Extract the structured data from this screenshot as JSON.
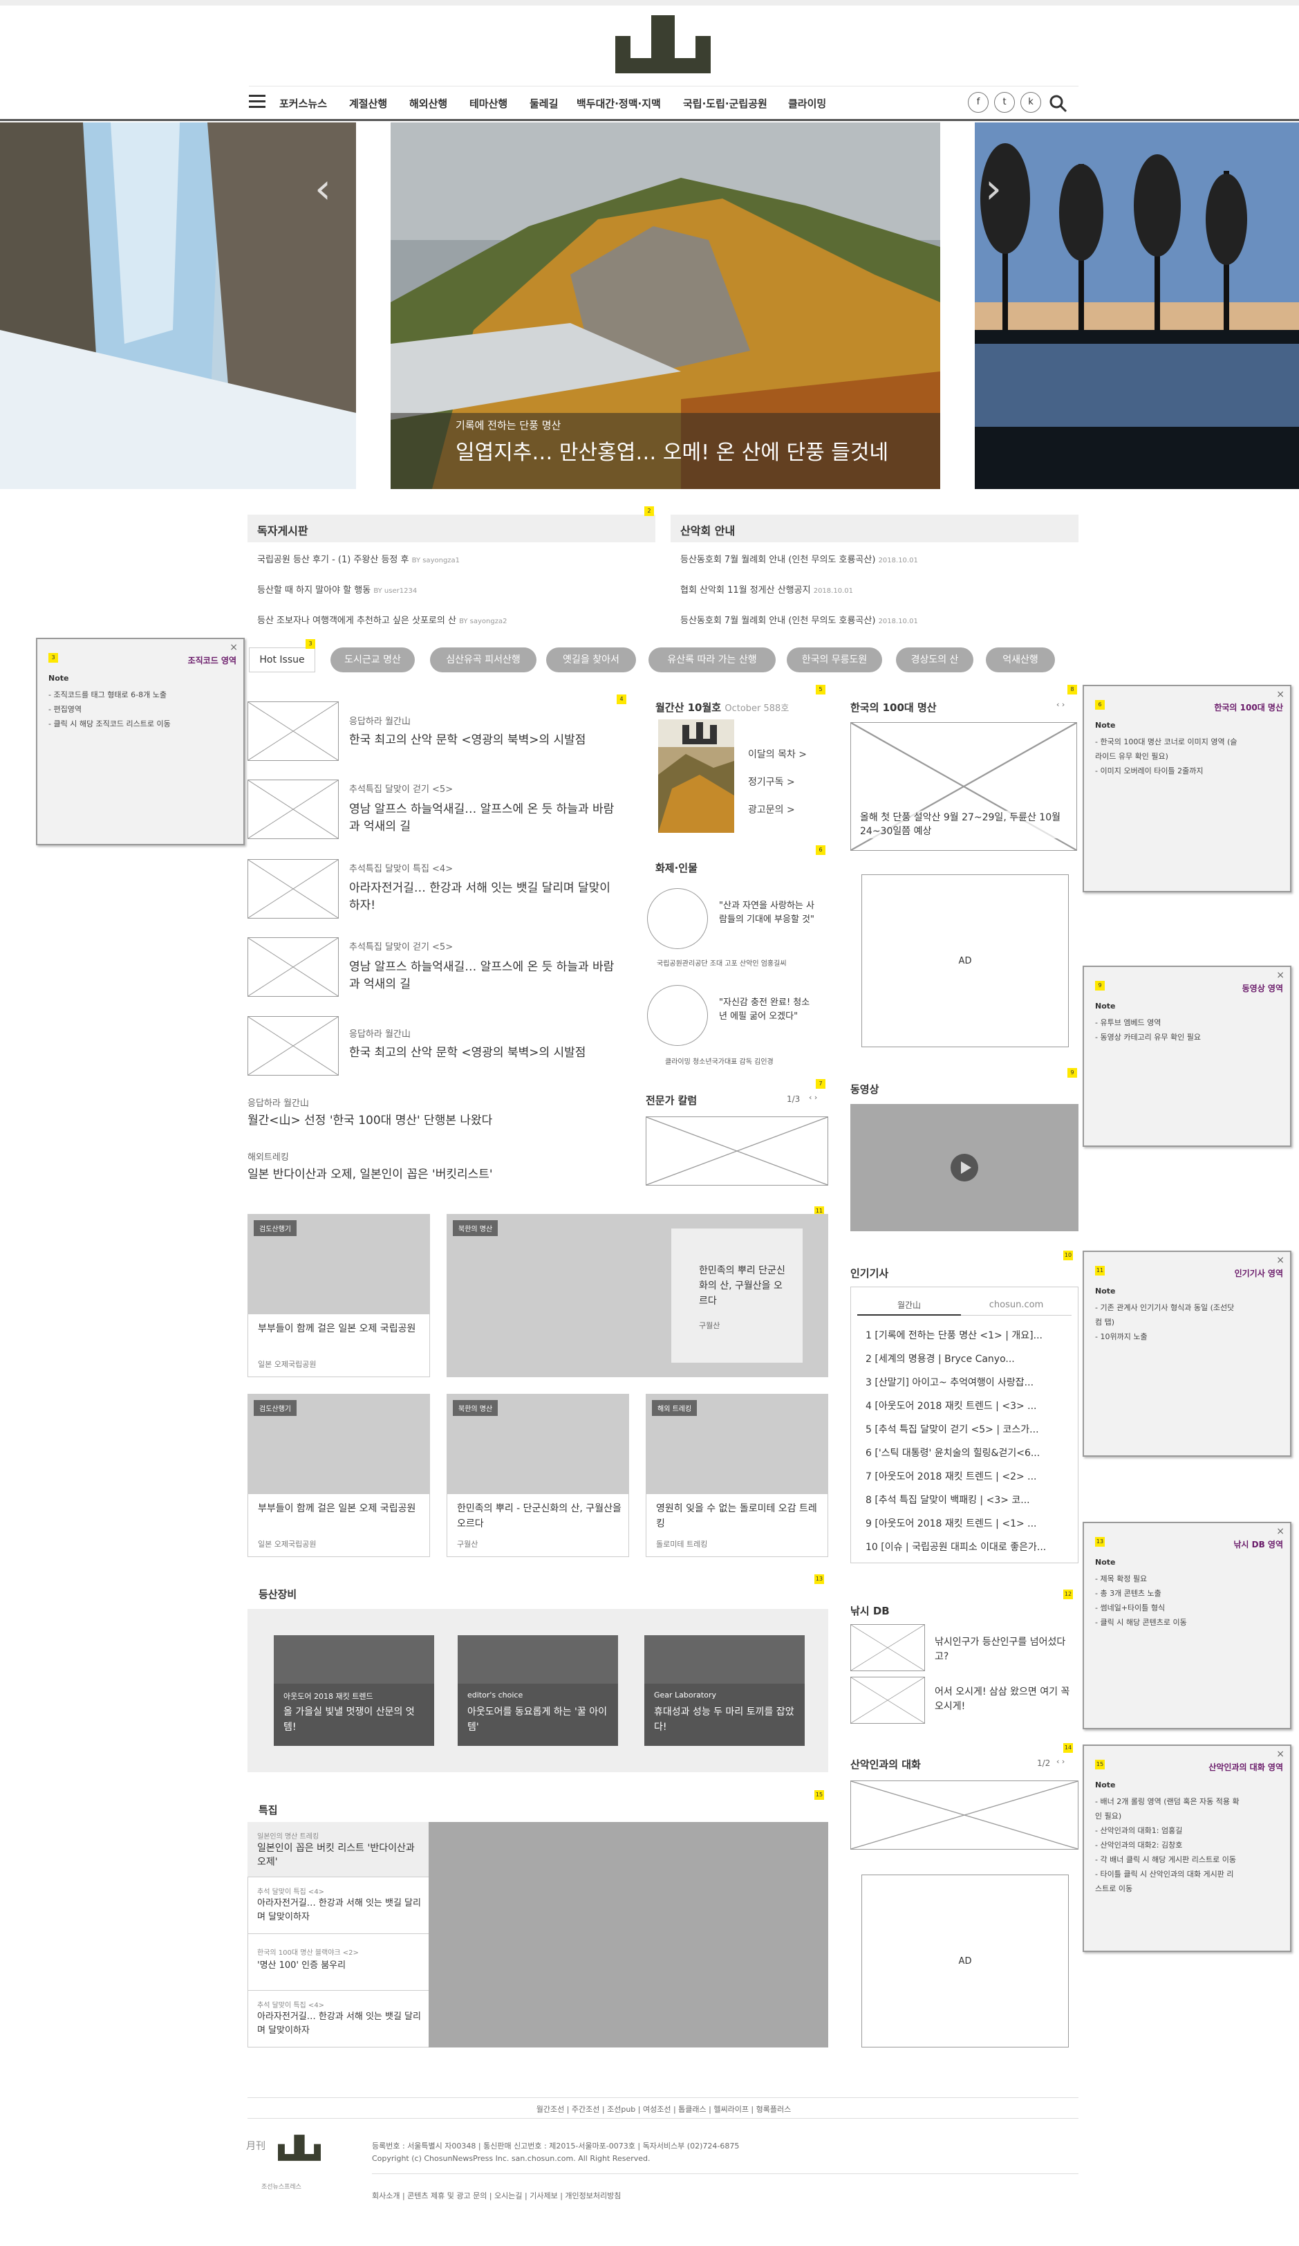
{
  "brand": {
    "logo": "山",
    "logo_small": "月刊",
    "publisher": "조선뉴스프레스"
  },
  "nav": {
    "items": [
      "포커스뉴스",
      "계절산행",
      "해외산행",
      "테마산행",
      "둘레길",
      "백두대간·정맥·지맥",
      "국립·도립·군립공원",
      "클라이밍"
    ],
    "social": [
      "f",
      "t",
      "k"
    ]
  },
  "hero": {
    "subtitle": "기록에 전하는 단풍 명산",
    "title": "일엽지추… 만산홍엽… 오메! 온 산에 단풍 들것네"
  },
  "readers_board": {
    "title": "독자게시판",
    "items": [
      {
        "text": "국립공원 등산 후기 - (1) 주왕산 등정 후",
        "by": "BY sayongza1"
      },
      {
        "text": "등산할 때 하지 말아야 할 행동",
        "by": "BY user1234"
      },
      {
        "text": "등산 조보자나 여행객에게 추천하고 싶은 삿포로의 산",
        "by": "BY sayongza2"
      }
    ]
  },
  "club_notice": {
    "title": "산악회 안내",
    "items": [
      {
        "text": "등산동호회 7월 월례회 안내 (인천 무의도 호룡곡산)",
        "date": "2018.10.01"
      },
      {
        "text": "협회 산악회 11월 정게산 산행공지",
        "date": "2018.10.01"
      },
      {
        "text": "등산동호회 7월 월례회 안내 (인천 무의도 호룡곡산)",
        "date": "2018.10.01"
      }
    ]
  },
  "hot_issue": {
    "label": "Hot Issue",
    "tags": [
      "도시근교 명산",
      "심산유곡 피서산행",
      "옛길을 찾아서",
      "유산록 따라 가는 산행",
      "한국의 무릉도원",
      "경상도의 산",
      "억새산행"
    ]
  },
  "articles": [
    {
      "cat": "응답하라 월간山",
      "title": "한국 최고의 산악 문학 <영광의 북벽>의 시발점"
    },
    {
      "cat": "추석특집 달맞이 걷기 <5>",
      "title": "영남 알프스 하늘억새길… 알프스에 온 듯 하늘과 바람과 억새의 길"
    },
    {
      "cat": "추석특집 달맞이 특집 <4>",
      "title": "아라자전거길… 한강과 서해 잇는 뱃길 달리며 달맞이하자!"
    },
    {
      "cat": "추석특집 달맞이 걷기 <5>",
      "title": "영남 알프스 하늘억새길… 알프스에 온 듯 하늘과 바람과 억새의 길"
    },
    {
      "cat": "응답하라 월간山",
      "title": "한국 최고의 산악 문학 <영광의 북벽>의 시발점"
    }
  ],
  "text_articles": [
    {
      "cat": "응답하라 월간山",
      "title": "월간<山> 선정 '한국 100대 명산' 단행본 나왔다"
    },
    {
      "cat": "해외트레킹",
      "title": "일본 반다이산과 오제, 일본인이 꼽은 '버킷리스트'"
    }
  ],
  "monthly": {
    "title": "월간산 10월호",
    "sub": "October 588호",
    "links": [
      "이달의 목차",
      "정기구독",
      "광고문의"
    ]
  },
  "people": {
    "title": "화제·인물",
    "items": [
      {
        "quote": "\"산과 자연을 사랑하는 사람들의 기대에 부응할 것\"",
        "cap": "국립공원관리공단 조대 고포 산악인 엄홍길씨"
      },
      {
        "quote": "\"자신감 충전 완료! 청소년 에필 굶어 오겠다\"",
        "cap": "클라이밍 청소년국가대표 감독 김인경"
      }
    ]
  },
  "column": {
    "title": "전문가 칼럼",
    "page": "1/3"
  },
  "top100": {
    "title": "한국의 100대 명산",
    "caption": "올해 첫 단풍 설악산 9월 27~29일, 두륜산 10월 24~30일쯤 예상"
  },
  "ad": {
    "label": "AD"
  },
  "video": {
    "title": "동영상"
  },
  "popular": {
    "title": "인기기사",
    "tabs": [
      "월간山",
      "chosun.com"
    ],
    "items": [
      "1  [기록에 전하는 단풍 명산 <1> | 개요]...",
      "2  [세계의 명용경 | Bryce Canyo...",
      "3  [산말기] 아이고~ 추억여행이 사랑잡...",
      "4  [아웃도어 2018 재킷 트렌드 | <3> ...",
      "5  [추석 특집 달맞이 걷기 <5> | 코스가...",
      "6  ['스틱 대통령' 윤치술의 힐링&걷기<6...",
      "7  [아웃도어 2018 재킷 트렌드 | <2> ...",
      "8  [추석 특집 달맞이 백패킹 | <3> 코...",
      "9  [아웃도어 2018 재킷 트렌드 | <1> ...",
      "10  [이슈 | 국립공원 대피소 이대로 좋은가..."
    ]
  },
  "fishing": {
    "title": "낚시 DB",
    "items": [
      "낚시인구가 등산인구를 넘어섰다고?",
      "어서 오시게! 삼삼 왔으면 여기 꼭 오시게!"
    ]
  },
  "talk": {
    "title": "산악인과의 대화",
    "page": "1/2"
  },
  "cards_row1": [
    {
      "label": "검도산행기",
      "title": "부부들이 함께 걸은 일본 오제 국립공원",
      "sub": "일본 오제국립공원"
    },
    {
      "label": "북한의 명산",
      "title": "한민족의 뿌리 단군신화의 산, 구월산을 오르다",
      "sub": "구월산"
    }
  ],
  "cards_row2": [
    {
      "label": "검도산행기",
      "title": "부부들이 함께 걸은 일본 오제 국립공원",
      "sub": "일본 오제국립공원"
    },
    {
      "label": "북한의 명산",
      "title": "한민족의 뿌리 - 단군신화의 산, 구월산을 오르다",
      "sub": "구월산"
    },
    {
      "label": "해외 트레킹",
      "title": "영원히 잊을 수 없는 돌로미테 오감 트레킹",
      "sub": "돌로미테 트레킹"
    }
  ],
  "equipment": {
    "title": "등산장비",
    "items": [
      {
        "label": "아웃도어 2018 재킷 트렌드",
        "title": "올 가을실 빛낼 멋쟁이 산문의 엇템!"
      },
      {
        "label": "editor's choice",
        "title": "아웃도어를 동요롭게 하는 '꿀 아이템'"
      },
      {
        "label": "Gear Laboratory",
        "title": "휴대성과 성능 두 마리 토끼를 잡았다!"
      }
    ]
  },
  "special": {
    "title": "특집",
    "items": [
      {
        "cat": "일본인의 명산 트레킹",
        "title": "일본인이 꼽은 버킷 리스트 '반다이산과 오제'"
      },
      {
        "cat": "추석 달맞이 특집 <4>",
        "title": "아라자전거길… 한강과 서해 잇는 뱃길 달리며 달맞이하자"
      },
      {
        "cat": "한국의 100대 명산 블랙야크 <2>",
        "title": "'명산 100' 인증 붐우리"
      },
      {
        "cat": "추석 달맞이 특집 <4>",
        "title": "아라자전거길… 한강과 서해 잇는 뱃길 달리며 달맞이하자"
      }
    ]
  },
  "notes": [
    {
      "num": "3",
      "title": "조직코드 영역",
      "label": "Note",
      "lines": [
        "- 조직코드를 태그 형태로 6-8개 노출",
        "- 편집영역",
        "- 클릭 시 해당 조직코드 리스트로 이동"
      ]
    },
    {
      "num": "6",
      "title": "한국의 100대 명산",
      "label": "Note",
      "lines": [
        "- 한국의 100대 명산 코너로 이미지 영역 (슬",
        "  라이드 유무 확인 필요)",
        "- 이미지 오버레이 타이틀 2줄까지"
      ]
    },
    {
      "num": "9",
      "title": "동영상 영역",
      "label": "Note",
      "lines": [
        "- 유투브 엠베드 영역",
        "- 동영상 카테고리 유무 확인 필요"
      ]
    },
    {
      "num": "11",
      "title": "인기기사 영역",
      "label": "Note",
      "lines": [
        "- 기존 관계사 인기기사 형식과 동일 (조선닷",
        "  컴 탭)",
        "- 10위까지 노출"
      ]
    },
    {
      "num": "13",
      "title": "낚시 DB 영역",
      "label": "Note",
      "lines": [
        "- 제목 확정 필요",
        "- 총 3개 콘텐츠 노출",
        "- 썸네일+타이틀 형식",
        "- 클릭 시 해당 콘텐츠로 이동"
      ]
    },
    {
      "num": "15",
      "title": "산악인과의 대화 영역",
      "label": "Note",
      "lines": [
        "- 배너 2개 롤링 영역 (랜덤 혹은 자동 적용 확",
        "  인 필요)",
        "- 산악인과의 대화1: 엄홍길",
        "- 산악인과의 대화2: 김창호",
        "- 각 배너 클릭 시 해당 게시판 리스트로 이동",
        "- 타이틀 클릭 시 산악인과의 대화 게시판 리",
        "  스트로 이동"
      ]
    }
  ],
  "badges": [
    "2",
    "3",
    "4",
    "5",
    "6",
    "7",
    "8",
    "9",
    "10",
    "11",
    "12",
    "13",
    "14",
    "15"
  ],
  "footer": {
    "links": "월간조선 | 주간조선 | 조선pub | 여성조선 | 톱클래스 | 헬씨라이프 | 형록플러스",
    "info1": "등록번호 : 서울특별시 자00348 | 통신판매 신고번호 : 제2015-서울마포-0073호 | 독자서비스부 (02)724-6875",
    "info2": "Copyright (c) ChosunNewsPress Inc. san.chosun.com. All Right Reserved.",
    "info3": "회사소개 | 콘텐츠 제휴 및 광고 문의 | 오시는길 | 기사제보 | 개인정보처리방침"
  },
  "colors": {
    "logo": "#3b3f30",
    "tag_bg": "#aaaaaa",
    "note_title": "#6a1b6a",
    "badge": "#ffe800"
  }
}
